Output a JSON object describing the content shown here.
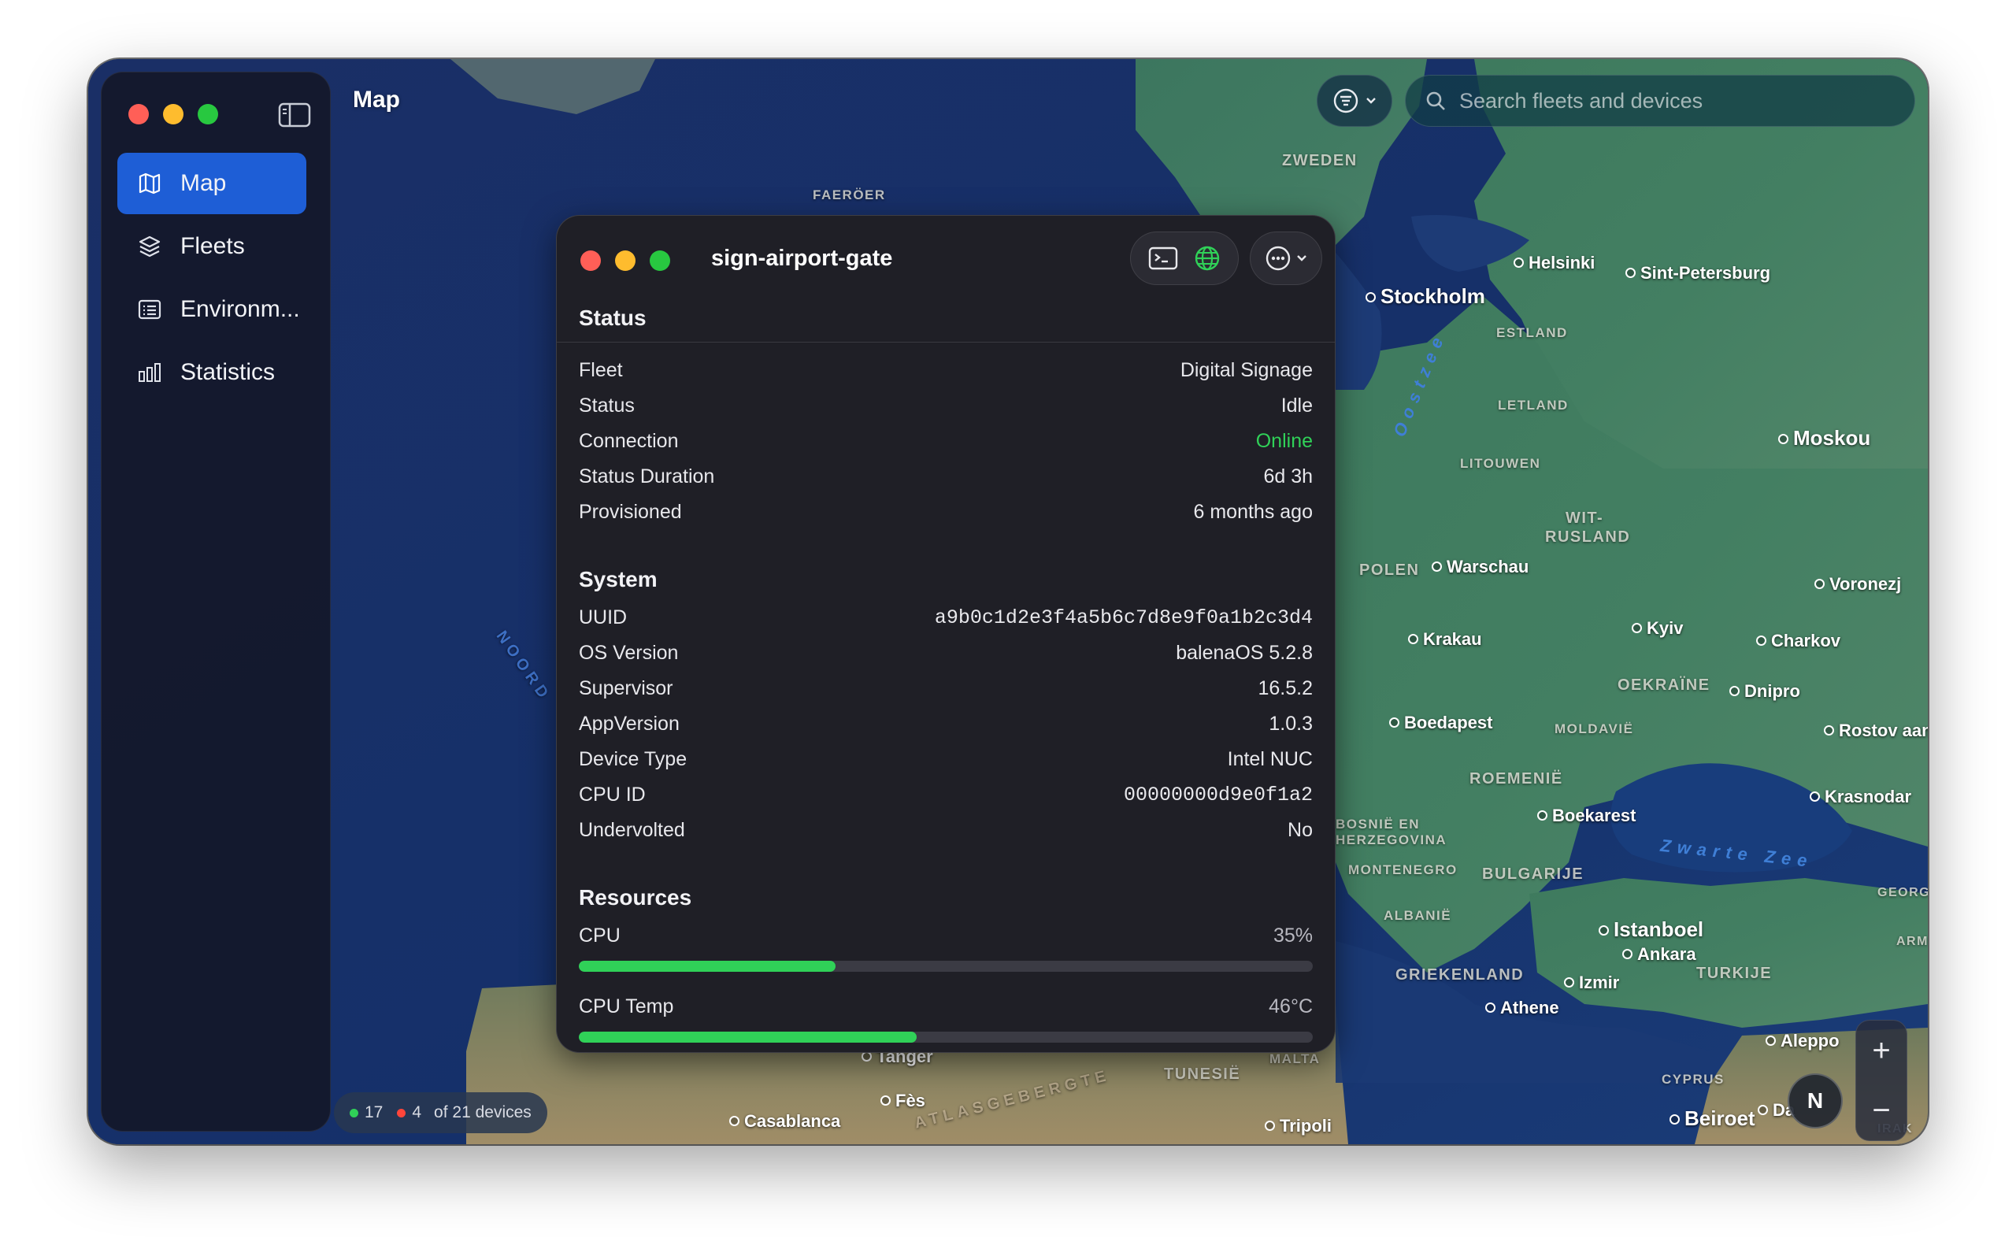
{
  "window": {
    "title": "Map"
  },
  "sidebar": {
    "items": [
      {
        "label": "Map",
        "icon": "map-icon",
        "active": true
      },
      {
        "label": "Fleets",
        "icon": "layers-icon",
        "active": false
      },
      {
        "label": "Environm...",
        "icon": "list-icon",
        "active": false
      },
      {
        "label": "Statistics",
        "icon": "bar-chart-icon",
        "active": false
      }
    ]
  },
  "search": {
    "placeholder": "Search fleets and devices"
  },
  "device_count": {
    "online": "17",
    "offline": "4",
    "total_text": "of 21 devices"
  },
  "colors": {
    "accent": "#1e5ed6",
    "online": "#30d158",
    "offline": "#ff453a"
  },
  "map_labels": {
    "countries": [
      "ZWEDEN",
      "FAERÖER",
      "ESTLAND",
      "LETLAND",
      "LITOUWEN",
      "WIT-",
      "RUSLAND",
      "POLEN",
      "OEKRAÏNE",
      "MOLDAVIË",
      "ROEMENIË",
      "BOSNIË EN",
      "HERZEGOVINA",
      "MONTENEGRO",
      "BULGARIJE",
      "ALBANIË",
      "GRIEKENLAND",
      "TURKIJE",
      "CYPRUS",
      "TUNESIË",
      "MALTA",
      "GEORG",
      "IRAK",
      "ARM"
    ],
    "cities": [
      "Helsinki",
      "Sint-Petersburg",
      "Stockholm",
      "Moskou",
      "Warschau",
      "Voronezj",
      "Kyiv",
      "Charkov",
      "Krakau",
      "Dnipro",
      "Boedapest",
      "Rostov aan",
      "Boekarest",
      "Krasnodar",
      "Istanboel",
      "Ankara",
      "Izmir",
      "Athene",
      "Aleppo",
      "Beiroet",
      "Da",
      "Tripoli",
      "Casablanca",
      "Fès",
      "Tanger"
    ],
    "seas": [
      "Oostzee",
      "Zwarte Zee"
    ],
    "misc": [
      "ATLASGEBERGTE",
      "NOORD"
    ]
  },
  "device": {
    "name": "sign-airport-gate",
    "status_section": {
      "title": "Status",
      "rows": [
        {
          "label": "Fleet",
          "value": "Digital Signage"
        },
        {
          "label": "Status",
          "value": "Idle"
        },
        {
          "label": "Connection",
          "value": "Online"
        },
        {
          "label": "Status Duration",
          "value": "6d 3h"
        },
        {
          "label": "Provisioned",
          "value": "6 months ago"
        }
      ]
    },
    "system_section": {
      "title": "System",
      "rows": [
        {
          "label": "UUID",
          "value": "a9b0c1d2e3f4a5b6c7d8e9f0a1b2c3d4"
        },
        {
          "label": "OS Version",
          "value": "balenaOS 5.2.8"
        },
        {
          "label": "Supervisor",
          "value": "16.5.2"
        },
        {
          "label": "AppVersion",
          "value": "1.0.3"
        },
        {
          "label": "Device Type",
          "value": "Intel NUC"
        },
        {
          "label": "CPU ID",
          "value": "00000000d9e0f1a2"
        },
        {
          "label": "Undervolted",
          "value": "No"
        }
      ]
    },
    "resources_section": {
      "title": "Resources",
      "rows": [
        {
          "label": "CPU",
          "value": "35%",
          "fraction": 0.35
        },
        {
          "label": "CPU Temp",
          "value": "46°C",
          "fraction": 0.46
        }
      ]
    }
  },
  "map_controls": {
    "zoom_in": "+",
    "zoom_out": "−",
    "compass": "N"
  }
}
